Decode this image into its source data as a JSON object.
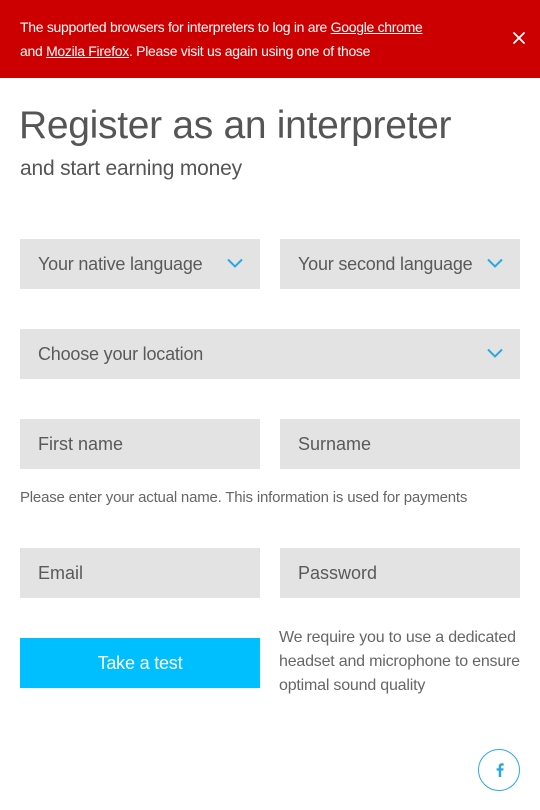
{
  "banner": {
    "text_before": "The supported browsers for interpreters to log in are ",
    "chrome_link": "Google chrome",
    "and_text": "and ",
    "firefox_link": "Mozila Firefox",
    "text_after": ". Please visit us again using one of those",
    "close_icon": "close-icon",
    "background_color": "#cc0000"
  },
  "header": {
    "title": "Register as an interpreter",
    "subtitle": "and start earning money"
  },
  "form": {
    "native_language": {
      "value": "Your native language",
      "icon": "chevron-down-icon"
    },
    "second_language": {
      "value": "Your second language",
      "icon": "chevron-down-icon"
    },
    "location": {
      "value": "Choose your location",
      "icon": "chevron-down-icon"
    },
    "first_name": {
      "placeholder": "First name"
    },
    "surname": {
      "placeholder": "Surname"
    },
    "name_hint": "Please enter your actual name. This information is used for payments",
    "email": {
      "placeholder": "Email"
    },
    "password": {
      "placeholder": "Password"
    },
    "submit_label": "Take a test",
    "headset_note": "We require you to use a dedicated headset and microphone to ensure optimal sound quality"
  },
  "social": {
    "facebook_icon": "facebook-icon"
  },
  "colors": {
    "accent": "#00bfff",
    "chevron": "#2aa9e0",
    "field_background": "#e3e3e3",
    "text": "#555555"
  }
}
